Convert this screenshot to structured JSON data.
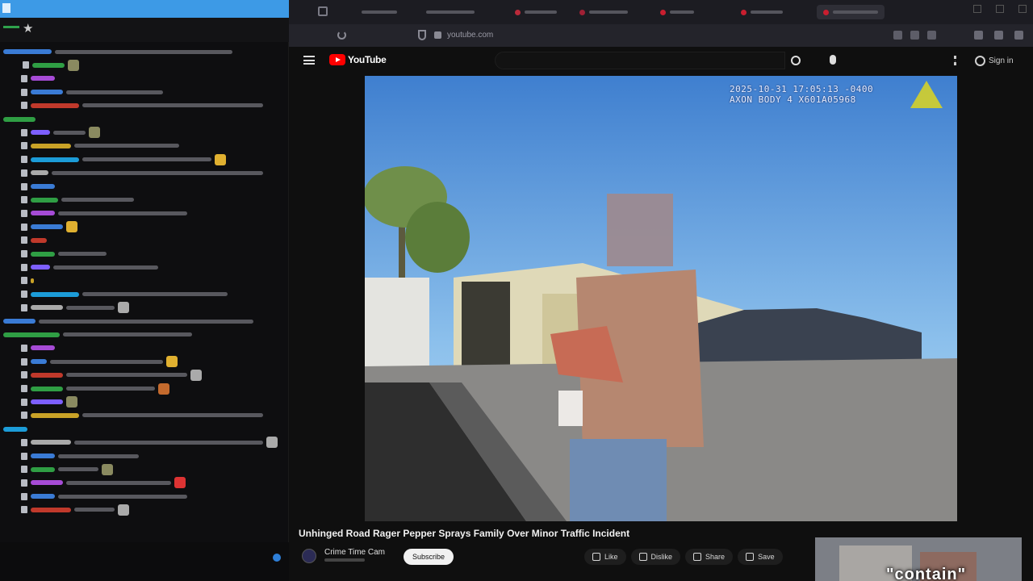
{
  "browser": {
    "url": "youtube.com"
  },
  "youtube": {
    "logo_text": "YouTube",
    "signin_label": "Sign in",
    "video": {
      "timestamp_line1": "2025-10-31 17:05:13 -0400",
      "timestamp_line2": "AXON BODY 4 X601A05968",
      "title": "Unhinged Road Rager Pepper Sprays Family Over Minor Traffic Incident",
      "channel": "Crime Time Cam",
      "subscribe_label": "Subscribe",
      "actions": [
        "Like",
        "Dislike",
        "Share",
        "Save"
      ]
    }
  },
  "overlay": {
    "caption": "\"contain\""
  },
  "colors": {
    "chat_topbar": "#3d9ae6",
    "youtube_red": "#ff0000",
    "sky": "#6aa9e0"
  }
}
